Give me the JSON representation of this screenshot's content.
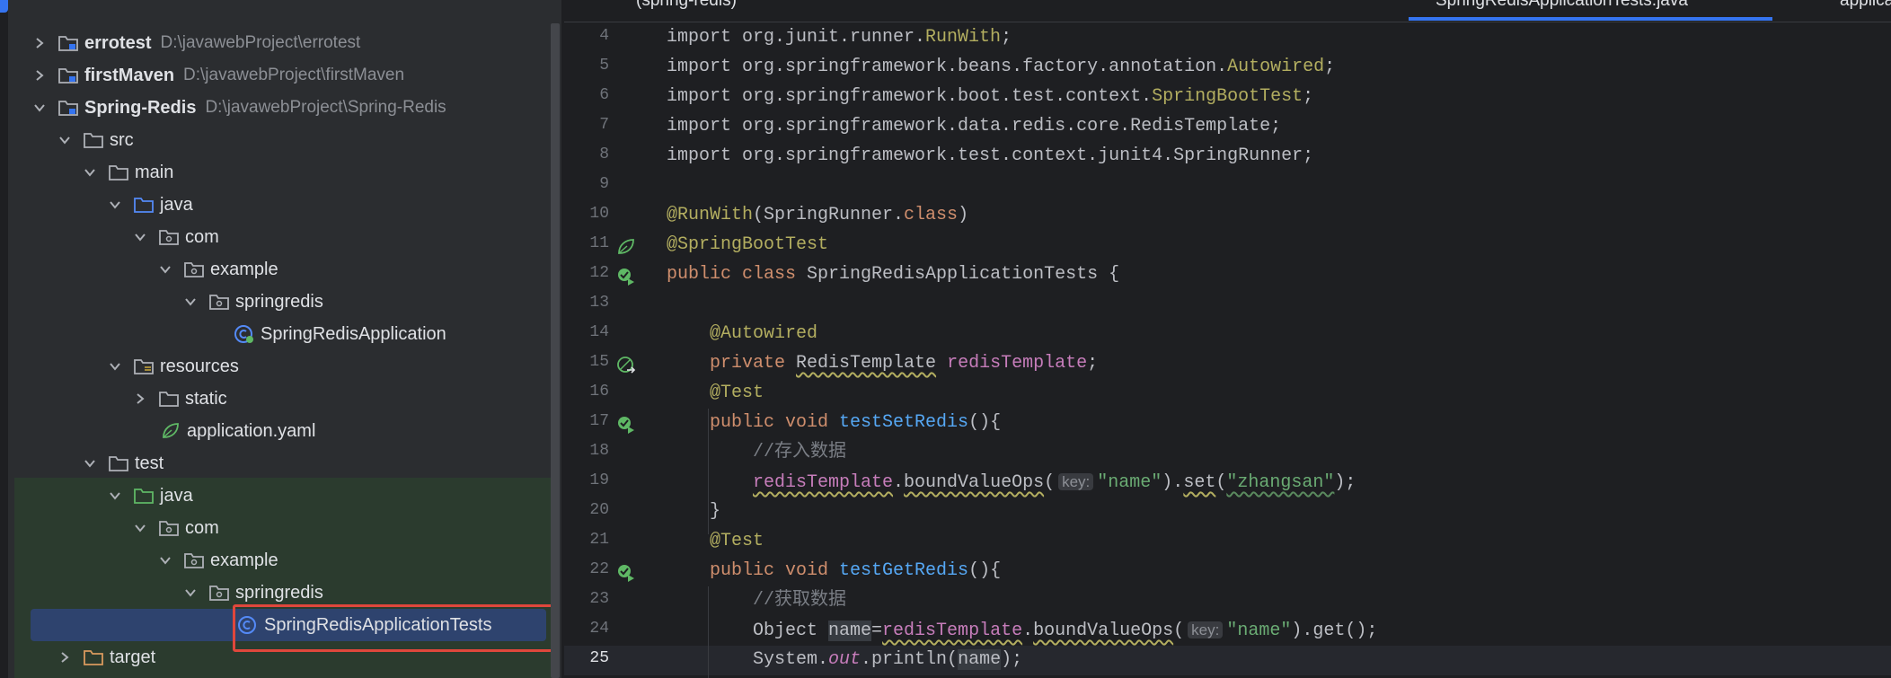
{
  "project_tree": {
    "items": [
      {
        "name": "errotest",
        "path": "D:\\javawebProject\\errotest",
        "type": "module",
        "expanded": false
      },
      {
        "name": "firstMaven",
        "path": "D:\\javawebProject\\firstMaven",
        "type": "module",
        "expanded": false
      },
      {
        "name": "Spring-Redis",
        "path": "D:\\javawebProject\\Spring-Redis",
        "type": "module",
        "expanded": true
      },
      {
        "name": "src",
        "type": "folder",
        "expanded": true
      },
      {
        "name": "main",
        "type": "folder",
        "expanded": true
      },
      {
        "name": "java",
        "type": "source-root",
        "expanded": true
      },
      {
        "name": "com",
        "type": "package",
        "expanded": true
      },
      {
        "name": "example",
        "type": "package",
        "expanded": true
      },
      {
        "name": "springredis",
        "type": "package",
        "expanded": true
      },
      {
        "name": "SpringRedisApplication",
        "type": "spring-class"
      },
      {
        "name": "resources",
        "type": "resources-root",
        "expanded": true
      },
      {
        "name": "static",
        "type": "folder",
        "expanded": false
      },
      {
        "name": "application.yaml",
        "type": "yaml"
      },
      {
        "name": "test",
        "type": "folder",
        "expanded": true
      },
      {
        "name": "java",
        "type": "test-root",
        "expanded": true
      },
      {
        "name": "com",
        "type": "package",
        "expanded": true
      },
      {
        "name": "example",
        "type": "package",
        "expanded": true
      },
      {
        "name": "springredis",
        "type": "package",
        "expanded": true
      },
      {
        "name": "SpringRedisApplicationTests",
        "type": "class",
        "selected": true
      },
      {
        "name": "target",
        "type": "excluded-folder",
        "expanded": false
      }
    ]
  },
  "tabs": {
    "fragment_1": "(spring-redis)",
    "fragment_2": "SpringRedisApplicationTests.java",
    "fragment_3": "application.yaml"
  },
  "editor": {
    "current_line": 25,
    "line_numbers": [
      "4",
      "5",
      "6",
      "7",
      "8",
      "9",
      "10",
      "11",
      "12",
      "13",
      "14",
      "15",
      "16",
      "17",
      "18",
      "19",
      "20",
      "21",
      "22",
      "23",
      "24",
      "25"
    ],
    "hint_key_label": "key:",
    "lines": {
      "l4a": "import org.junit.runner.",
      "l4b": "RunWith",
      "l4c": ";",
      "l5a": "import org.springframework.beans.factory.annotation.",
      "l5b": "Autowired",
      "l5c": ";",
      "l6a": "import org.springframework.boot.test.context.",
      "l6b": "SpringBootTest",
      "l6c": ";",
      "l7a": "import org.springframework.data.redis.core.RedisTemplate;",
      "l8a": "import org.springframework.test.context.junit4.SpringRunner;",
      "l10a": "@RunWith",
      "l10b": "(SpringRunner.",
      "l10c": "class",
      "l10d": ")",
      "l11a": "@SpringBootTest",
      "l12a": "public class ",
      "l12b": "SpringRedisApplicationTests {",
      "l14a": "@Autowired",
      "l15a": "private ",
      "l15b": "RedisTemplate",
      "l15c": " ",
      "l15d": "redisTemplate",
      "l15e": ";",
      "l16a": "@Test",
      "l17a": "public void ",
      "l17b": "testSetRedis",
      "l17c": "(){",
      "l18a": "//存入数据",
      "l19a": "redisTemplate",
      "l19b": ".",
      "l19c": "boundValueOps",
      "l19d": "(",
      "l19e": "\"name\"",
      "l19f": ").",
      "l19g": "set",
      "l19h": "(",
      "l19i": "\"zhangsan\"",
      "l19j": ");",
      "l20a": "}",
      "l21a": "@Test",
      "l22a": "public void ",
      "l22b": "testGetRedis",
      "l22c": "(){",
      "l23a": "//获取数据",
      "l24a": "Object ",
      "l24b": "name",
      "l24c": "=",
      "l24d": "redisTemplate",
      "l24e": ".",
      "l24f": "boundValueOps",
      "l24g": "(",
      "l24h": "\"name\"",
      "l24i": ").get();",
      "l25a": "System.",
      "l25b": "out",
      "l25c": ".println(",
      "l25d": "name",
      "l25e": ");"
    }
  },
  "colors": {
    "panel_bg": "#2b2d30",
    "editor_bg": "#1e1f22",
    "selection": "#2e436e",
    "highlight_box": "#e0473c",
    "keyword": "#cf8e6d",
    "annotation": "#b3ae60",
    "string": "#6aab73",
    "method": "#56a8f5",
    "field": "#c77dbb"
  },
  "icons": {
    "spring_bean": "spring-leaf-icon",
    "run_test": "run-test-icon",
    "autowired_link": "autowired-navigate-icon"
  }
}
